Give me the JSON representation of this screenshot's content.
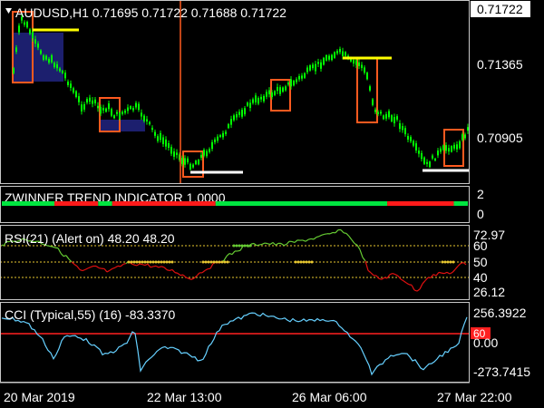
{
  "symbol_header": "AUDUSD,H1  0.71695 0.71722 0.71688 0.71722",
  "price_axis": {
    "current_price": "0.71722",
    "ticks": [
      "0.71365",
      "0.70905"
    ]
  },
  "zwinner": {
    "title": "ZWINNER TREND INDICATOR 1.0000",
    "scale": [
      "2",
      "0"
    ],
    "segments": [
      {
        "color": "green",
        "from": 0,
        "to": 30
      },
      {
        "color": "red",
        "from": 30,
        "to": 55
      },
      {
        "color": "green",
        "from": 55,
        "to": 63
      },
      {
        "color": "red",
        "from": 63,
        "to": 122
      },
      {
        "color": "green",
        "from": 122,
        "to": 220
      },
      {
        "color": "red",
        "from": 220,
        "to": 258
      },
      {
        "color": "green",
        "from": 258,
        "to": 266
      }
    ]
  },
  "rsi": {
    "title": "RSI(21) (Alert on) 48.20 48.20",
    "max_label": "72.97",
    "min_label": "26.12",
    "levels": [
      "60",
      "50",
      "40"
    ]
  },
  "cci": {
    "title": "CCI (Typical,55) (16) -83.3370",
    "max_label": "256.3922",
    "zero_label": "0.00",
    "level_label": "60",
    "min_label": "-273.7415"
  },
  "time_axis": [
    "20 Mar 2019",
    "22 Mar 13:00",
    "26 Mar 06:00",
    "27 Mar 22:00"
  ],
  "colors": {
    "background": "#000000",
    "candle": "#00ff00",
    "box_fill": "#1c1f6e",
    "box_border": "#ff5a1f",
    "yellow_level": "#ffff00",
    "white_level": "#ffffff",
    "separator": "#ff5a1f",
    "zw_green": "#00e640",
    "zw_red": "#ff1a1a",
    "rsi_up": "#66cc33",
    "rsi_down": "#e01010",
    "rsi_level": "#e8c830",
    "cci_line": "#66d0ff",
    "cci_level": "#ff2020"
  }
}
